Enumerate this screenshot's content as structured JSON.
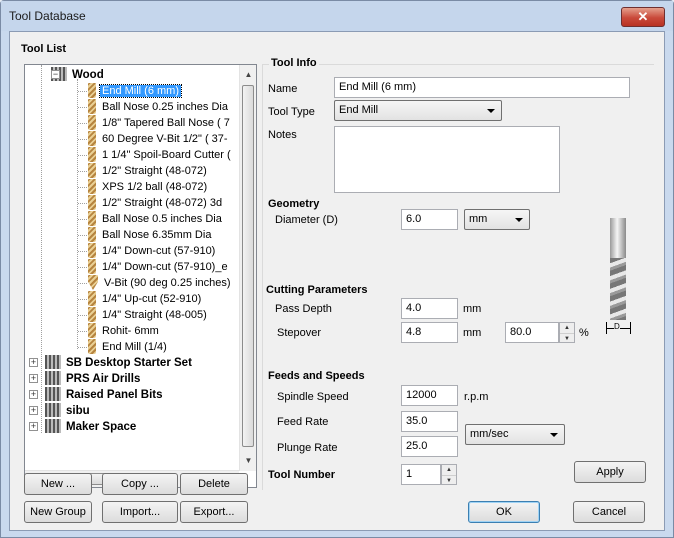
{
  "window": {
    "title": "Tool Database",
    "close_glyph": "✕"
  },
  "tool_list": {
    "heading": "Tool List",
    "wood_group": "Wood",
    "wood_tools": [
      "End Mill (6 mm)",
      "Ball Nose 0.25 inches Dia",
      "1/8\" Tapered Ball Nose ( 7",
      "60 Degree V-Bit 1/2\"  ( 37-",
      "1 1/4\" Spoil-Board Cutter (",
      "1/2\" Straight  (48-072)",
      "XPS 1/2 ball  (48-072)",
      "1/2\" Straight  (48-072) 3d",
      "Ball Nose 0.5 inches Dia",
      "Ball Nose 6.35mm Dia",
      "1/4\"  Down-cut (57-910)",
      "1/4\"  Down-cut (57-910)_e",
      "V-Bit (90 deg 0.25 inches)",
      "1/4\" Up-cut (52-910)",
      "1/4\" Straight  (48-005)",
      "Rohit- 6mm",
      "End Mill (1/4)"
    ],
    "other_groups": [
      "SB Desktop Starter Set",
      "PRS Air Drills",
      "Raised Panel Bits",
      "sibu",
      "Maker Space"
    ],
    "buttons": {
      "new": "New ...",
      "copy": "Copy ...",
      "delete": "Delete",
      "new_group": "New Group",
      "import": "Import...",
      "export": "Export..."
    }
  },
  "tool_info": {
    "heading": "Tool Info",
    "name_label": "Name",
    "name_value": "End Mill (6 mm)",
    "tool_type_label": "Tool Type",
    "tool_type_value": "End Mill",
    "notes_label": "Notes",
    "notes_value": "",
    "image_dim_label": "D"
  },
  "geometry": {
    "heading": "Geometry",
    "diameter_label": "Diameter (D)",
    "diameter_value": "6.0",
    "units_value": "mm"
  },
  "cutting": {
    "heading": "Cutting Parameters",
    "pass_depth_label": "Pass Depth",
    "pass_depth_value": "4.0",
    "pass_depth_unit": "mm",
    "stepover_label": "Stepover",
    "stepover_value": "4.8",
    "stepover_unit": "mm",
    "stepover_percent": "80.0",
    "percent_sign": "%"
  },
  "feeds": {
    "heading": "Feeds and Speeds",
    "spindle_label": "Spindle Speed",
    "spindle_value": "12000",
    "spindle_unit": "r.p.m",
    "feed_label": "Feed Rate",
    "feed_value": "35.0",
    "plunge_label": "Plunge Rate",
    "plunge_value": "25.0",
    "rate_units": "mm/sec"
  },
  "tool_number": {
    "label": "Tool Number",
    "value": "1"
  },
  "actions": {
    "apply": "Apply",
    "ok": "OK",
    "cancel": "Cancel"
  }
}
